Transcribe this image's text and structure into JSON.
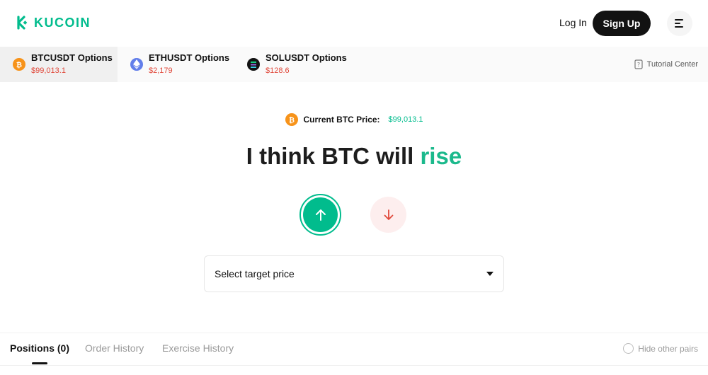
{
  "header": {
    "brand": "KUCOIN",
    "login_label": "Log In",
    "signup_label": "Sign Up",
    "accent": "#01bc8d"
  },
  "pairs": [
    {
      "name": "BTCUSDT Options",
      "price": "$99,013.1",
      "icon": "bitcoin-icon",
      "color": "#f7931a",
      "active": true
    },
    {
      "name": "ETHUSDT Options",
      "price": "$2,179",
      "icon": "ethereum-icon",
      "color": "#627eea",
      "active": false
    },
    {
      "name": "SOLUSDT Options",
      "price": "$128.6",
      "icon": "solana-icon",
      "color": "#121212",
      "active": false
    }
  ],
  "tutorial_label": "Tutorial Center",
  "main": {
    "current_price_label": "Current BTC Price:",
    "current_price_value": "$99,013.1",
    "headline_prefix": "I think BTC will",
    "headline_direction": "rise",
    "up_color": "#01bc8d",
    "down_color": "#e0483a",
    "select_placeholder": "Select target price"
  },
  "bottom_tabs": [
    {
      "label": "Positions (0)",
      "active": true
    },
    {
      "label": "Order History",
      "active": false
    },
    {
      "label": "Exercise History",
      "active": false
    }
  ],
  "hide_pairs_label": "Hide other pairs"
}
